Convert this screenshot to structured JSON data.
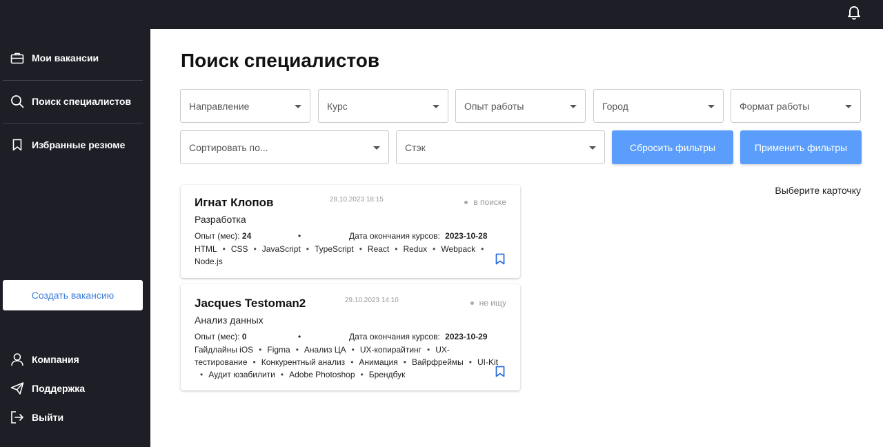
{
  "sidebar": {
    "items": [
      {
        "label": "Мои вакансии",
        "icon": "briefcase-icon"
      },
      {
        "label": "Поиск специалистов",
        "icon": "search-icon"
      },
      {
        "label": "Избранные резюме",
        "icon": "bookmark-icon"
      }
    ],
    "create_button": "Создать вакансию",
    "bottom_items": [
      {
        "label": "Компания",
        "icon": "user-icon"
      },
      {
        "label": "Поддержка",
        "icon": "send-icon"
      },
      {
        "label": "Выйти",
        "icon": "logout-icon"
      }
    ]
  },
  "header": {
    "icon": "bell-icon"
  },
  "main": {
    "title": "Поиск специалистов",
    "filters": {
      "direction": "Направление",
      "course": "Курс",
      "experience": "Опыт работы",
      "city": "Город",
      "work_format": "Формат работы",
      "sort": "Сортировать по...",
      "stack": "Стэк"
    },
    "reset_button": "Сбросить фильтры",
    "apply_button": "Применить фильтры",
    "hint": "Выберите карточку",
    "cards": [
      {
        "name": "Игнат Клопов",
        "date": "28.10.2023 18:15",
        "status": "в поиске",
        "specialty": "Разработка",
        "experience_label": "Опыт (мес):",
        "experience_value": "24",
        "separator": "•",
        "course_end_label": "Дата окончания курсов:",
        "course_end_value": "2023-10-28",
        "tags": [
          "HTML",
          "CSS",
          "JavaScript",
          "TypeScript",
          "React",
          "Redux",
          "Webpack",
          "Node.js"
        ]
      },
      {
        "name": "Jacques Testoman2",
        "date": "29.10.2023 14:10",
        "status": "не ищу",
        "specialty": "Анализ данных",
        "experience_label": "Опыт (мес):",
        "experience_value": "0",
        "separator": "•",
        "course_end_label": "Дата окончания курсов:",
        "course_end_value": "2023-10-29",
        "tags": [
          "Гайдлайны iOS",
          "Figma",
          "Анализ ЦА",
          "UX-копирайтинг",
          "UX-тестирование",
          "Конкурентный анализ",
          "Анимация",
          "Вайрфреймы",
          "UI-Kit",
          "Аудит юзабилити",
          "Adobe Photoshop",
          "Брендбук"
        ]
      }
    ]
  },
  "colors": {
    "dark": "#1d1e26",
    "accent": "#5b9dfa",
    "link": "#3d7fe0",
    "bookmark": "#2f6fe0"
  }
}
